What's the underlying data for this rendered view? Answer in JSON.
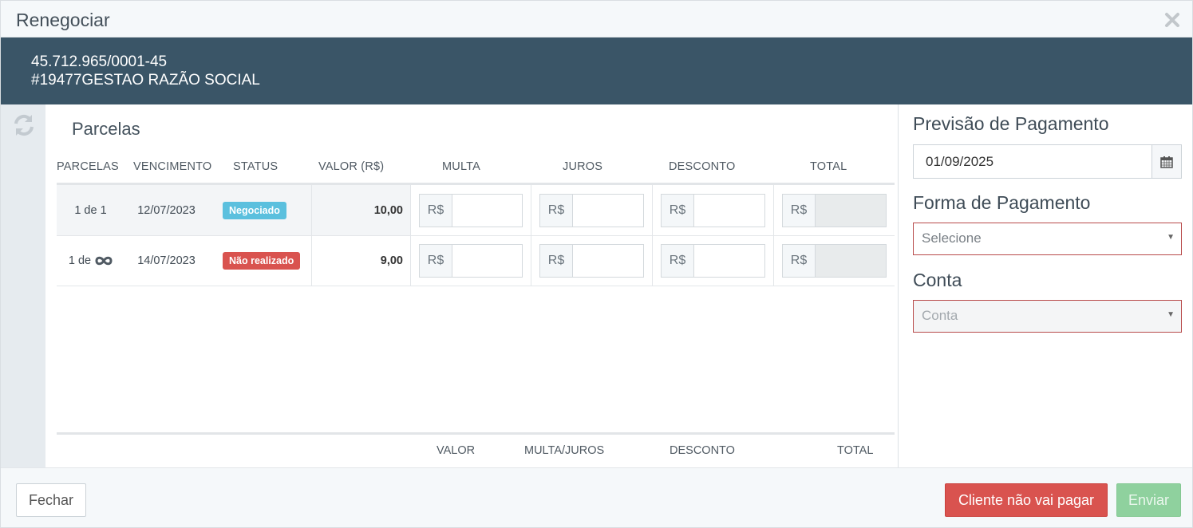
{
  "modal": {
    "title": "Renegociar"
  },
  "client": {
    "document": "45.712.965/0001-45",
    "name": "#19477GESTAO RAZÃO SOCIAL"
  },
  "section": {
    "title": "Parcelas"
  },
  "table": {
    "headers": [
      "PARCELAS",
      "VENCIMENTO",
      "STATUS",
      "VALOR (R$)",
      "MULTA",
      "JUROS",
      "DESCONTO",
      "TOTAL"
    ],
    "currency_prefix": "R$",
    "rows": [
      {
        "parcela": "1 de 1",
        "vencimento": "12/07/2023",
        "status": "Negociado",
        "status_color": "#5bc0de",
        "valor": "10,00",
        "multa": "",
        "juros": "",
        "desconto": "",
        "total": ""
      },
      {
        "parcela": "1 de",
        "parcela_icon": "infinity-icon",
        "vencimento": "14/07/2023",
        "status": "Não realizado",
        "status_color": "#d9534f",
        "valor": "9,00",
        "multa": "",
        "juros": "",
        "desconto": "",
        "total": ""
      }
    ],
    "footer_headers": [
      "VALOR",
      "MULTA/JUROS",
      "DESCONTO",
      "TOTAL"
    ]
  },
  "side": {
    "payment_forecast_label": "Previsão de Pagamento",
    "payment_forecast_value": "01/09/2025",
    "payment_method_label": "Forma de Pagamento",
    "payment_method_value": "Selecione",
    "account_label": "Conta",
    "account_value": "Conta"
  },
  "footer": {
    "close_label": "Fechar",
    "no_pay_label": "Cliente não vai pagar",
    "send_label": "Enviar"
  },
  "colors": {
    "header_bar": "#3a5567",
    "danger": "#d9534f",
    "info": "#5bc0de",
    "success_disabled": "#8fd19e"
  }
}
